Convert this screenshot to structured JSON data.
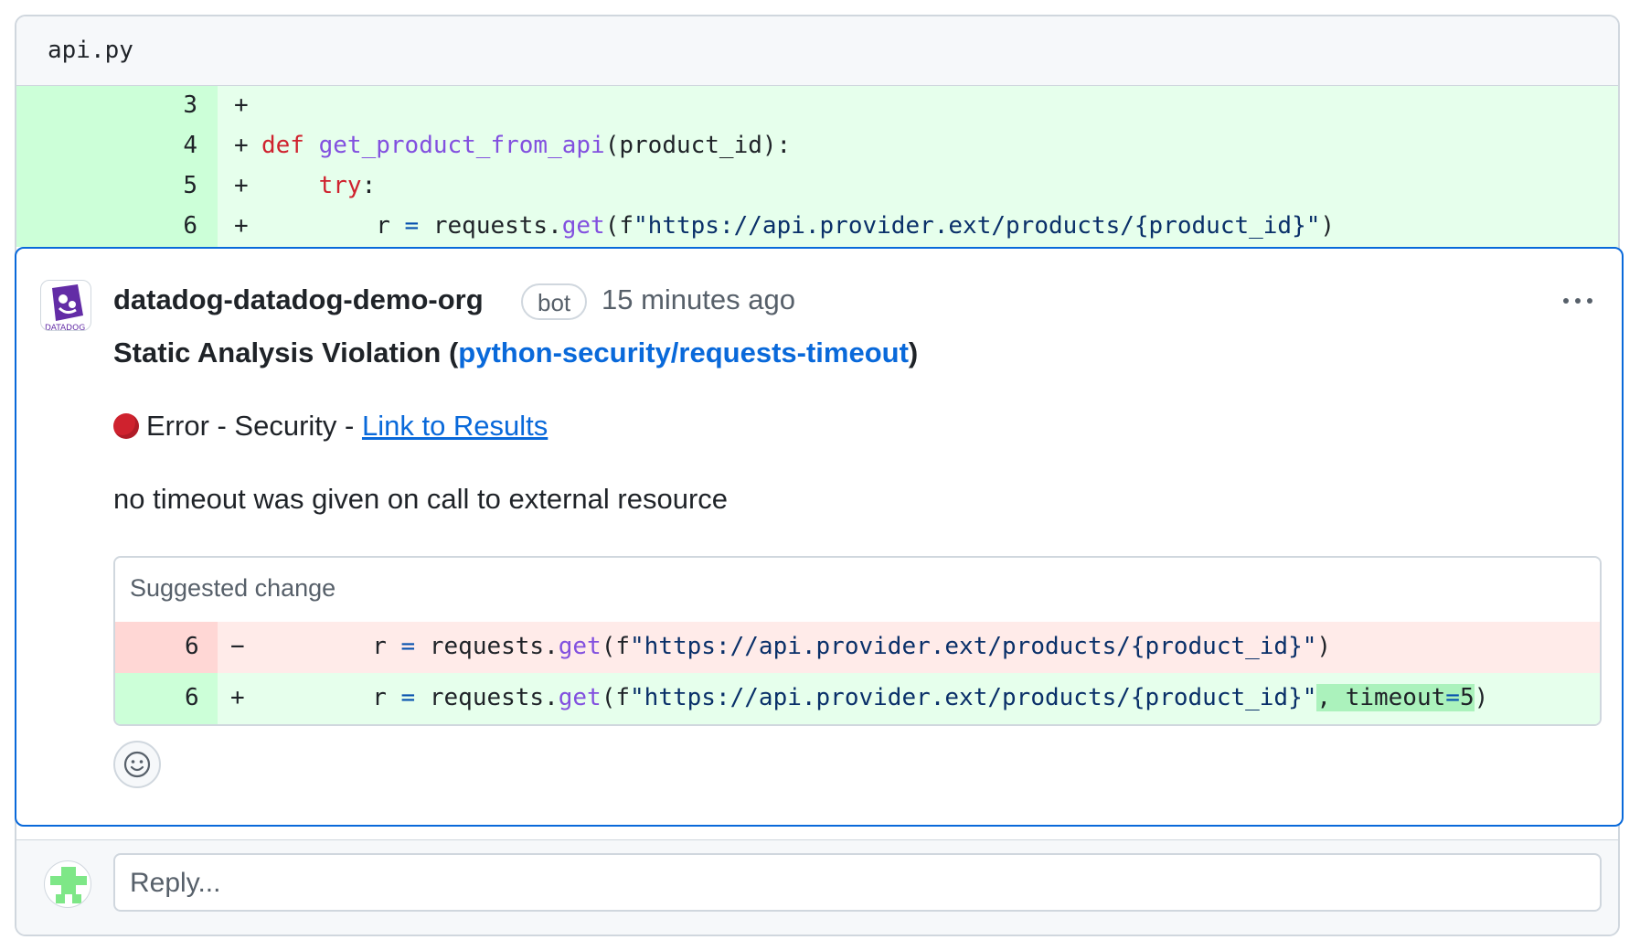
{
  "file": {
    "name": "api.py"
  },
  "diff_lines": [
    {
      "num": "3",
      "sign": "+",
      "code": ""
    },
    {
      "num": "4",
      "sign": "+",
      "code": "def get_product_from_api(product_id):"
    },
    {
      "num": "5",
      "sign": "+",
      "code": "    try:"
    },
    {
      "num": "6",
      "sign": "+",
      "code": "        r = requests.get(f\"https://api.provider.ext/products/{product_id}\")"
    }
  ],
  "comment": {
    "author": "datadog-datadog-demo-org",
    "badge": "bot",
    "time": "15 minutes ago",
    "title_prefix": "Static Analysis Violation (",
    "rule": "python-security/requests-timeout",
    "title_suffix": ")",
    "status_text": "Error - Security - ",
    "status_link": "Link to Results",
    "message": "no timeout was given on call to external resource",
    "more_icon": "kebab-horizontal-icon",
    "reaction_icon": "smiley-icon"
  },
  "suggestion": {
    "label": "Suggested change",
    "removed": {
      "num": "6",
      "sign": "−",
      "code": "        r = requests.get(f\"https://api.provider.ext/products/{product_id}\")"
    },
    "added": {
      "num": "6",
      "sign": "+",
      "code": "        r = requests.get(f\"https://api.provider.ext/products/{product_id}\"",
      "highlight": ", timeout=5",
      "tail": ")"
    }
  },
  "reply": {
    "placeholder": "Reply..."
  },
  "colors": {
    "accent": "#0969da",
    "error": "#cf222e",
    "added_bg": "#e6ffec",
    "removed_bg": "#ffebe9"
  }
}
